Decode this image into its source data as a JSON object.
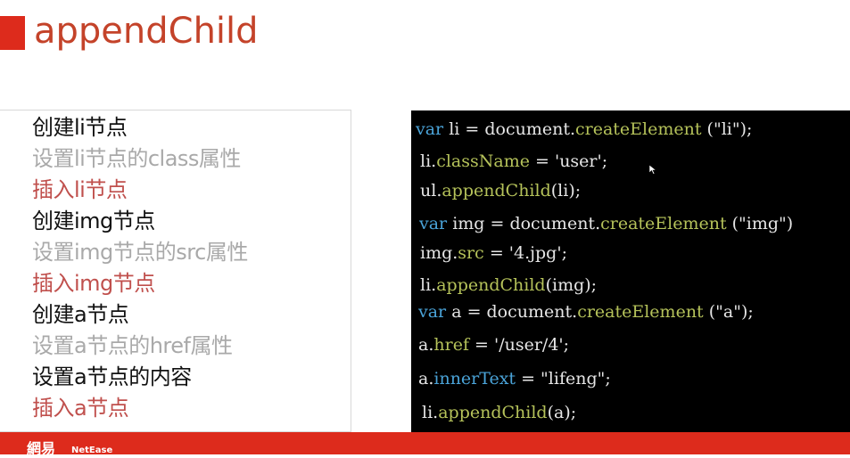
{
  "slide": {
    "title": "appendChild",
    "accent_color": "#dd2b1c",
    "title_color": "#c4432a"
  },
  "steps": [
    {
      "text": "创建li节点",
      "kind": "create"
    },
    {
      "text": "设置li节点的class属性",
      "kind": "set"
    },
    {
      "text": "插入li节点",
      "kind": "insert"
    },
    {
      "text": "创建img节点",
      "kind": "create"
    },
    {
      "text": "设置img节点的src属性",
      "kind": "set"
    },
    {
      "text": "插入img节点",
      "kind": "insert"
    },
    {
      "text": "创建a节点",
      "kind": "create"
    },
    {
      "text": "设置a节点的href属性",
      "kind": "set"
    },
    {
      "text": "设置a节点的内容",
      "kind": "create"
    },
    {
      "text": "插入a节点",
      "kind": "insert"
    }
  ],
  "code": [
    [
      {
        "t": "var",
        "c": "kw"
      },
      {
        "t": " li = document.",
        "c": "id"
      },
      {
        "t": "createElement",
        "c": "prop"
      },
      {
        "t": " (\"li\");",
        "c": "id"
      }
    ],
    [
      {
        "t": "li.",
        "c": "id"
      },
      {
        "t": "className",
        "c": "prop"
      },
      {
        "t": " = 'user';",
        "c": "id"
      }
    ],
    [
      {
        "t": "ul.",
        "c": "id"
      },
      {
        "t": "appendChild",
        "c": "prop"
      },
      {
        "t": "(li);",
        "c": "id"
      }
    ],
    [
      {
        "t": "var",
        "c": "kw"
      },
      {
        "t": " img = document.",
        "c": "id"
      },
      {
        "t": "createElement",
        "c": "prop"
      },
      {
        "t": " (\"img\")",
        "c": "id"
      }
    ],
    [
      {
        "t": "img.",
        "c": "id"
      },
      {
        "t": "src",
        "c": "prop"
      },
      {
        "t": " = '4.jpg';",
        "c": "id"
      }
    ],
    [
      {
        "t": "li.",
        "c": "id"
      },
      {
        "t": "appendChild",
        "c": "prop"
      },
      {
        "t": "(img);",
        "c": "id"
      }
    ],
    [
      {
        "t": "var",
        "c": "kw"
      },
      {
        "t": " a = document.",
        "c": "id"
      },
      {
        "t": "createElement",
        "c": "prop"
      },
      {
        "t": " (\"a\");",
        "c": "id"
      }
    ],
    [
      {
        "t": "a.",
        "c": "id"
      },
      {
        "t": "href",
        "c": "prop"
      },
      {
        "t": " = '/user/4';",
        "c": "id"
      }
    ],
    [
      {
        "t": "a.",
        "c": "id"
      },
      {
        "t": "innerText",
        "c": "kw"
      },
      {
        "t": " = \"lifeng\";",
        "c": "id"
      }
    ],
    [
      {
        "t": "li.",
        "c": "id"
      },
      {
        "t": "appendChild",
        "c": "prop"
      },
      {
        "t": "(a);",
        "c": "id"
      }
    ]
  ],
  "footer": {
    "logo": "網易",
    "logo_en": "NetEase"
  }
}
